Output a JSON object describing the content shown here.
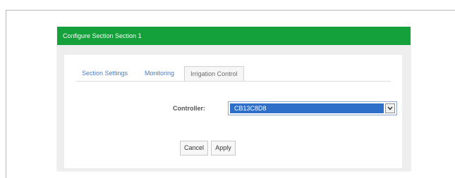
{
  "dialog": {
    "title": "Configure Section Section 1"
  },
  "tabs": [
    {
      "label": "Section Settings",
      "active": false
    },
    {
      "label": "Monitoring",
      "active": false
    },
    {
      "label": "Irrigation Control",
      "active": true
    }
  ],
  "form": {
    "controller_label": "Controller:",
    "controller_value": "CB13C8D8"
  },
  "buttons": {
    "cancel_label": "Cancel",
    "apply_label": "Apply"
  },
  "icons": {
    "dropdown": "chevron-down-icon"
  },
  "colors": {
    "header_green": "#14a03a",
    "tab_link_blue": "#4a7cc3",
    "selection_blue": "#2e6fc9"
  }
}
